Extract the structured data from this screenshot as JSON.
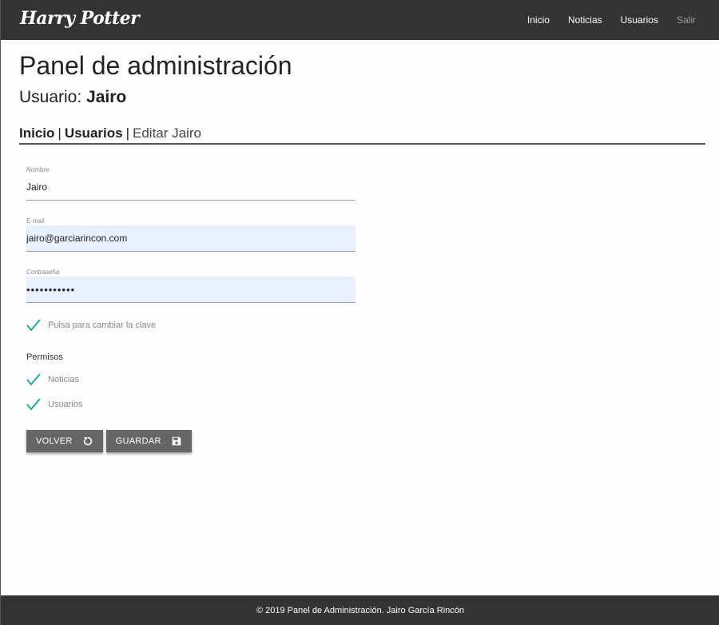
{
  "navbar": {
    "logo_text": "Harry Potter",
    "links": [
      {
        "label": "Inicio"
      },
      {
        "label": "Noticias"
      },
      {
        "label": "Usuarios"
      },
      {
        "label": "Salir"
      }
    ]
  },
  "header": {
    "title": "Panel de administración",
    "user_prefix": "Usuario:",
    "user_name": "Jairo"
  },
  "breadcrumb": {
    "items": [
      "Inicio",
      "Usuarios"
    ],
    "separator": "|",
    "current": "Editar Jairo"
  },
  "form": {
    "name": {
      "label": "Nombre",
      "value": "Jairo"
    },
    "email": {
      "label": "E-mail",
      "value": "jairo@garciarincon.com"
    },
    "password": {
      "label": "Contraseña",
      "value": "•••••••••••"
    },
    "change_password_label": "Pulsa para cambiar la clave",
    "permissions_label": "Permisos",
    "permissions": [
      {
        "label": "Noticias",
        "checked": true
      },
      {
        "label": "Usuarios",
        "checked": true
      }
    ],
    "back_button": "VOLVER",
    "save_button": "GUARDAR"
  },
  "footer": {
    "text": "© 2019 Panel de Administración. Jairo García Rincón"
  },
  "colors": {
    "navbar": "#333333",
    "check": "#26a69a",
    "button": "#666666",
    "autofill": "#e8f0fe"
  }
}
